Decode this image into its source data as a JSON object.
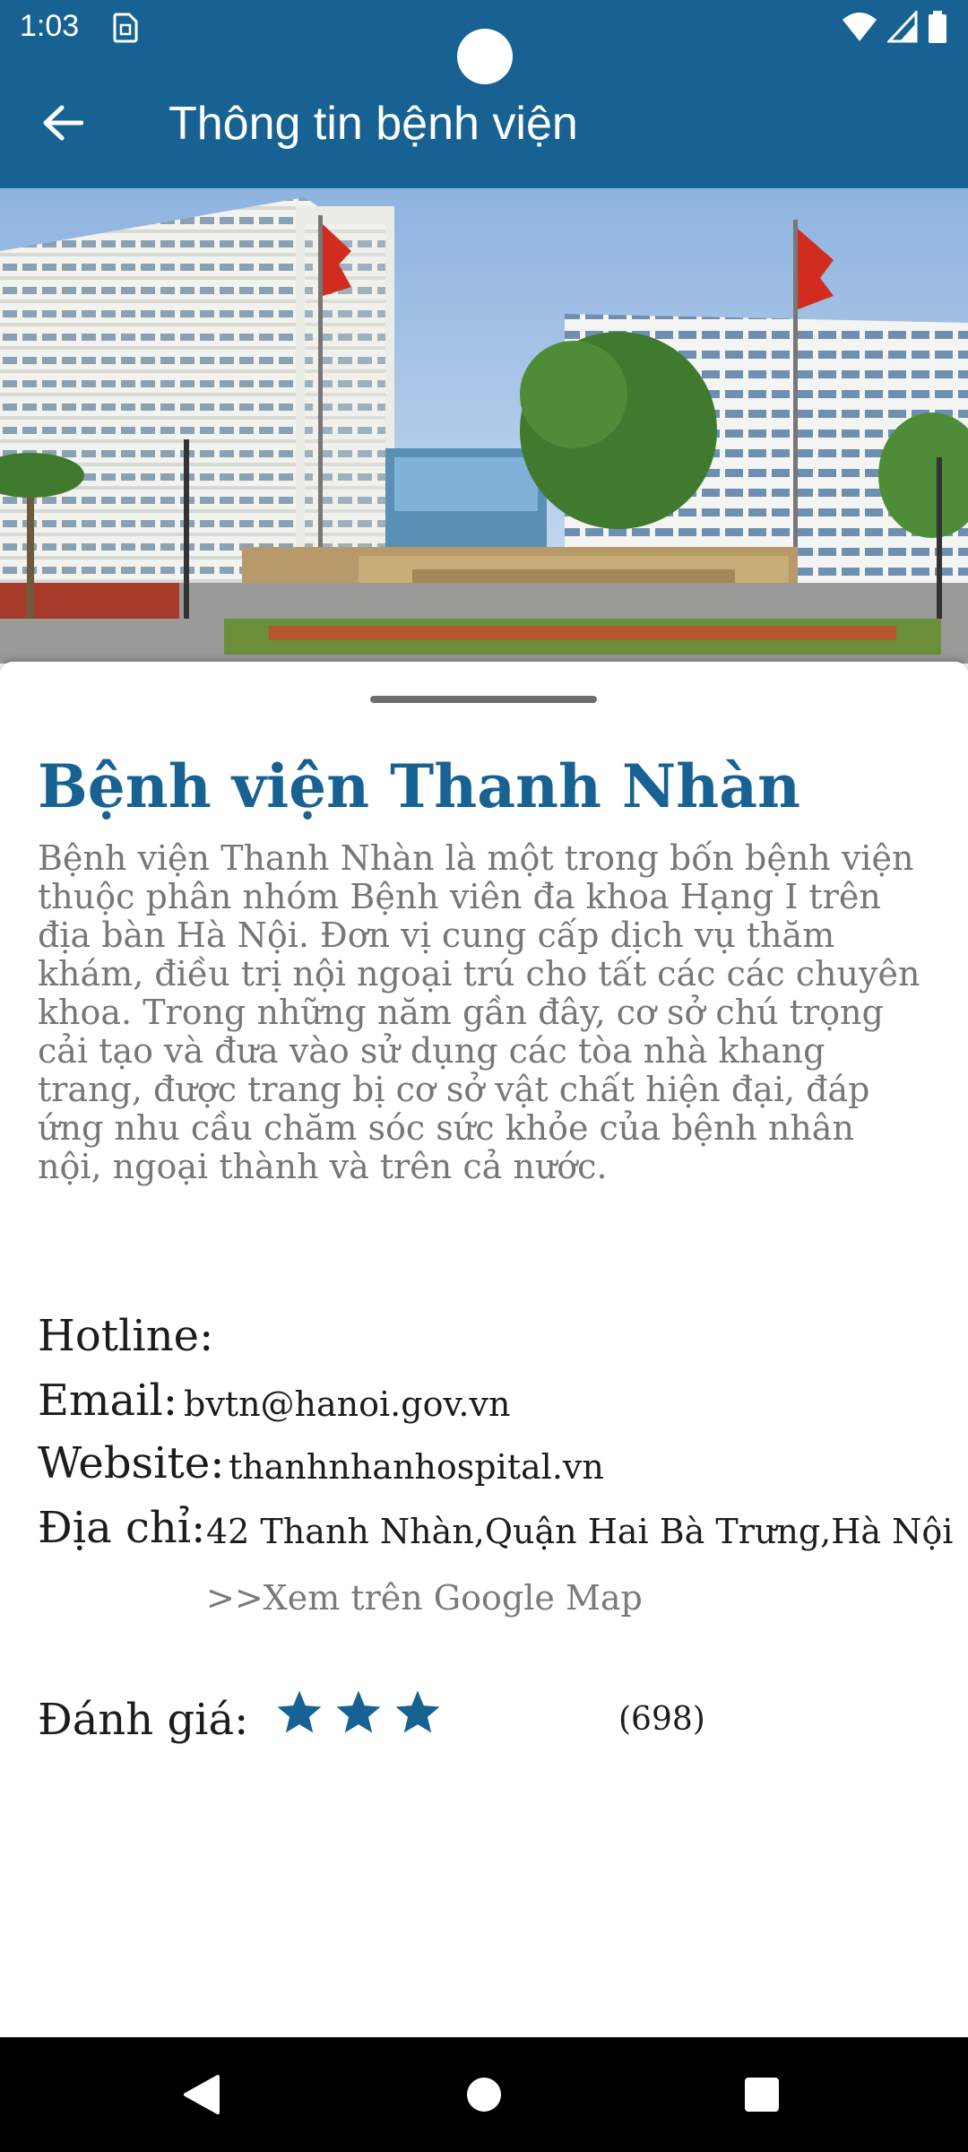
{
  "status_bar": {
    "time": "1:03",
    "icons": [
      "sim-card-icon",
      "wifi-icon",
      "cellular-signal-icon",
      "battery-icon"
    ]
  },
  "app_bar": {
    "title": "Thông tin bệnh viện",
    "back_icon": "arrow-left-icon"
  },
  "hospital": {
    "name": "Bệnh viện Thanh Nhàn",
    "description": "Bệnh viện Thanh Nhàn là một trong bốn bệnh viện thuộc phân nhóm Bệnh viên đa khoa Hạng I trên địa bàn Hà Nội. Đơn vị cung cấp dịch vụ thăm khám, điều trị nội ngoại trú cho tất các các chuyên khoa. Trong những năm gần đây, cơ sở chú trọng cải tạo và đưa vào sử dụng các tòa nhà khang trang, được trang bị cơ sở vật chất hiện đại, đáp ứng nhu cầu chăm sóc sức khỏe của bệnh nhân nội, ngoại thành và trên cả nước.",
    "hotline_label": "Hotline:",
    "hotline_value": "",
    "email_label": "Email:",
    "email_value": "bvtn@hanoi.gov.vn",
    "website_label": "Website:",
    "website_value": "thanhnhanhospital.vn",
    "address_label": "Địa chỉ:",
    "address_value": "42 Thanh Nhàn,Quận Hai Bà Trưng,Hà Nội",
    "map_link": ">>Xem trên Google Map",
    "rating_label": "Đánh giá:",
    "rating_stars": 3,
    "rating_count": "(698)"
  },
  "colors": {
    "primary": "#176293",
    "text": "#1c1c1c",
    "muted": "#777777"
  },
  "nav_bar": {
    "icons": [
      "back-triangle-icon",
      "home-circle-icon",
      "recents-square-icon"
    ]
  }
}
